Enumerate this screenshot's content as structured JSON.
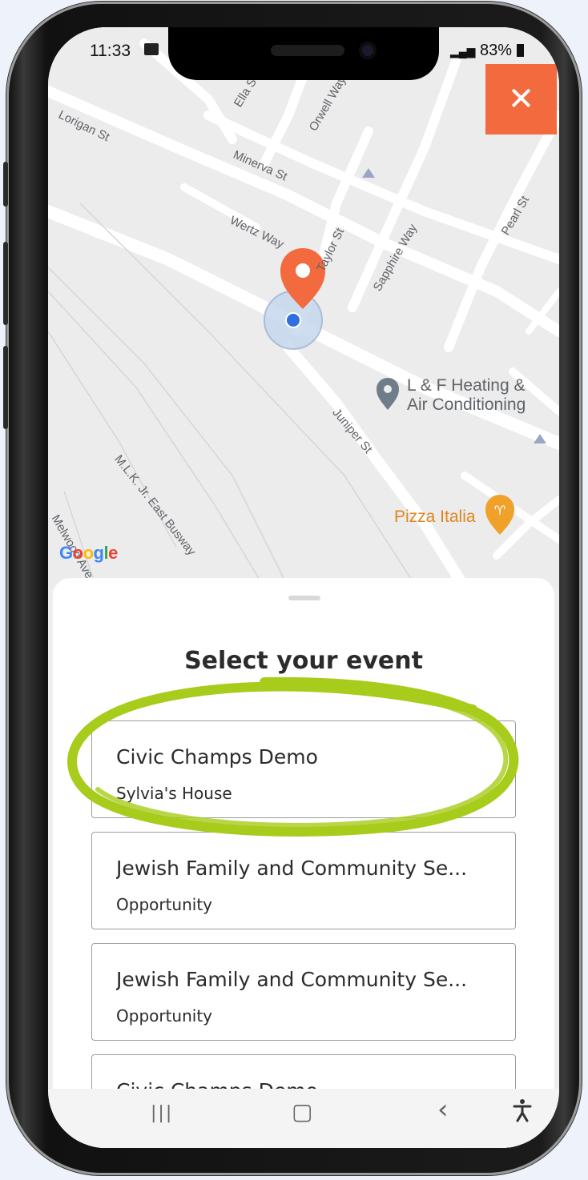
{
  "status_bar": {
    "time": "11:33",
    "battery": "83%"
  },
  "map": {
    "streets": [
      "Lorigan St",
      "Ella St",
      "Orwell Way",
      "Minerva St",
      "Wertz Way",
      "Taylor St",
      "Sapphire Way",
      "Pearl St",
      "Juniper St",
      "M.L.K. Jr. East Busway",
      "Melwood Ave"
    ],
    "pois": [
      {
        "name": "L & F Heating &\nAir Conditioning",
        "color": "#5f6368"
      },
      {
        "name": "Pizza Italia",
        "color": "#e0851e"
      }
    ],
    "google_logo": "Google",
    "pin_color": "#f26a3d",
    "location_dot_color": "#4285f4"
  },
  "close_button": {
    "label": "✕",
    "color": "#f26a3d"
  },
  "sheet": {
    "title": "Select your event",
    "events": [
      {
        "title": "Civic Champs Demo",
        "subtitle": "Sylvia's House"
      },
      {
        "title": "Jewish Family and Community Se...",
        "subtitle": "Opportunity"
      },
      {
        "title": "Jewish Family and Community Se...",
        "subtitle": "Opportunity"
      },
      {
        "title": "Civic Champs Demo",
        "subtitle": ""
      }
    ]
  },
  "nav_bar": {
    "recents": "|||",
    "home": "▢",
    "back": "‹",
    "accessibility": "accessibility-icon"
  },
  "highlight_color": "#a8cc1c"
}
